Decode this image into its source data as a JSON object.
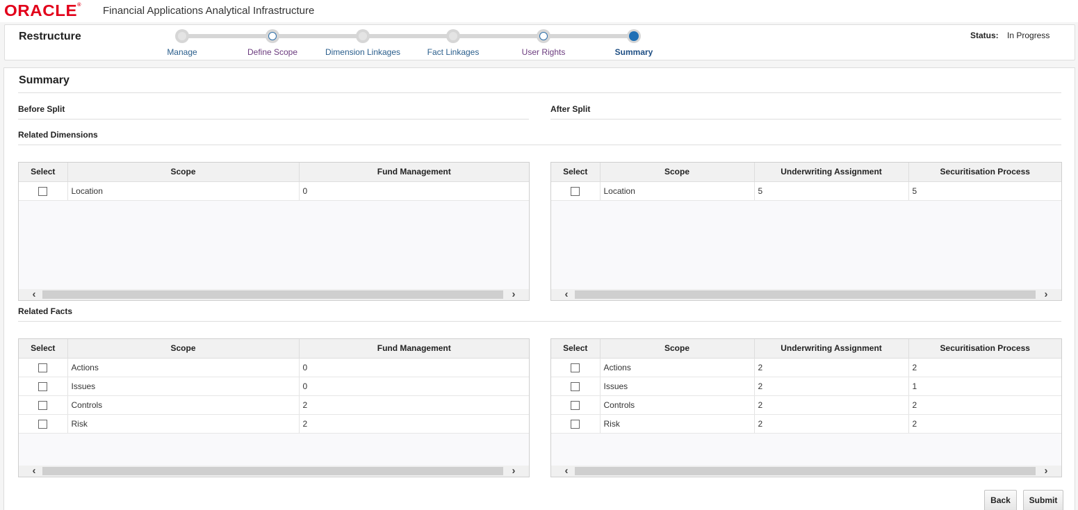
{
  "header": {
    "logo_text": "ORACLE",
    "logo_mark": "®",
    "app_title": "Financial Applications Analytical Infrastructure"
  },
  "train": {
    "title": "Restructure",
    "steps": [
      {
        "label": "Manage",
        "state": "visited"
      },
      {
        "label": "Define Scope",
        "state": "open"
      },
      {
        "label": "Dimension Linkages",
        "state": "visited"
      },
      {
        "label": "Fact Linkages",
        "state": "visited"
      },
      {
        "label": "User Rights",
        "state": "open"
      },
      {
        "label": "Summary",
        "state": "current"
      }
    ],
    "status_label": "Status:",
    "status_value": "In Progress"
  },
  "summary": {
    "title": "Summary",
    "before_split": "Before Split",
    "after_split": "After Split",
    "related_dimensions": "Related Dimensions",
    "related_facts": "Related Facts",
    "dimensions_before": {
      "columns": [
        "Select",
        "Scope",
        "Fund Management"
      ],
      "rows": [
        {
          "scope": "Location",
          "values": [
            "0"
          ]
        }
      ]
    },
    "dimensions_after": {
      "columns": [
        "Select",
        "Scope",
        "Underwriting Assignment",
        "Securitisation Process"
      ],
      "rows": [
        {
          "scope": "Location",
          "values": [
            "5",
            "5"
          ]
        }
      ]
    },
    "facts_before": {
      "columns": [
        "Select",
        "Scope",
        "Fund Management"
      ],
      "rows": [
        {
          "scope": "Actions",
          "values": [
            "0"
          ]
        },
        {
          "scope": "Issues",
          "values": [
            "0"
          ]
        },
        {
          "scope": "Controls",
          "values": [
            "2"
          ]
        },
        {
          "scope": "Risk",
          "values": [
            "2"
          ]
        }
      ]
    },
    "facts_after": {
      "columns": [
        "Select",
        "Scope",
        "Underwriting Assignment",
        "Securitisation Process"
      ],
      "rows": [
        {
          "scope": "Actions",
          "values": [
            "2",
            "2"
          ]
        },
        {
          "scope": "Issues",
          "values": [
            "2",
            "1"
          ]
        },
        {
          "scope": "Controls",
          "values": [
            "2",
            "2"
          ]
        },
        {
          "scope": "Risk",
          "values": [
            "2",
            "2"
          ]
        }
      ]
    },
    "scroll_left": "‹",
    "scroll_right": "›"
  },
  "buttons": {
    "back": "Back",
    "submit": "Submit"
  }
}
